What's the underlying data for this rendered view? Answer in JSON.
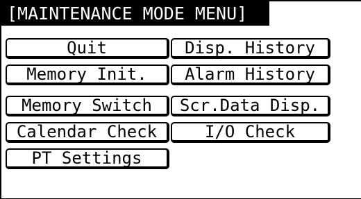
{
  "screen": {
    "title": "[MAINTENANCE MODE MENU]"
  },
  "menu": {
    "quit": "Quit",
    "disp_history": "Disp. History",
    "memory_init": "Memory Init.",
    "alarm_history": "Alarm History",
    "memory_switch": "Memory Switch",
    "scr_data_disp": "Scr.Data Disp.",
    "calendar_check": "Calendar Check",
    "io_check": "I/O Check",
    "pt_settings": "PT Settings"
  },
  "colors": {
    "background": "#ffffff",
    "foreground": "#000000"
  }
}
